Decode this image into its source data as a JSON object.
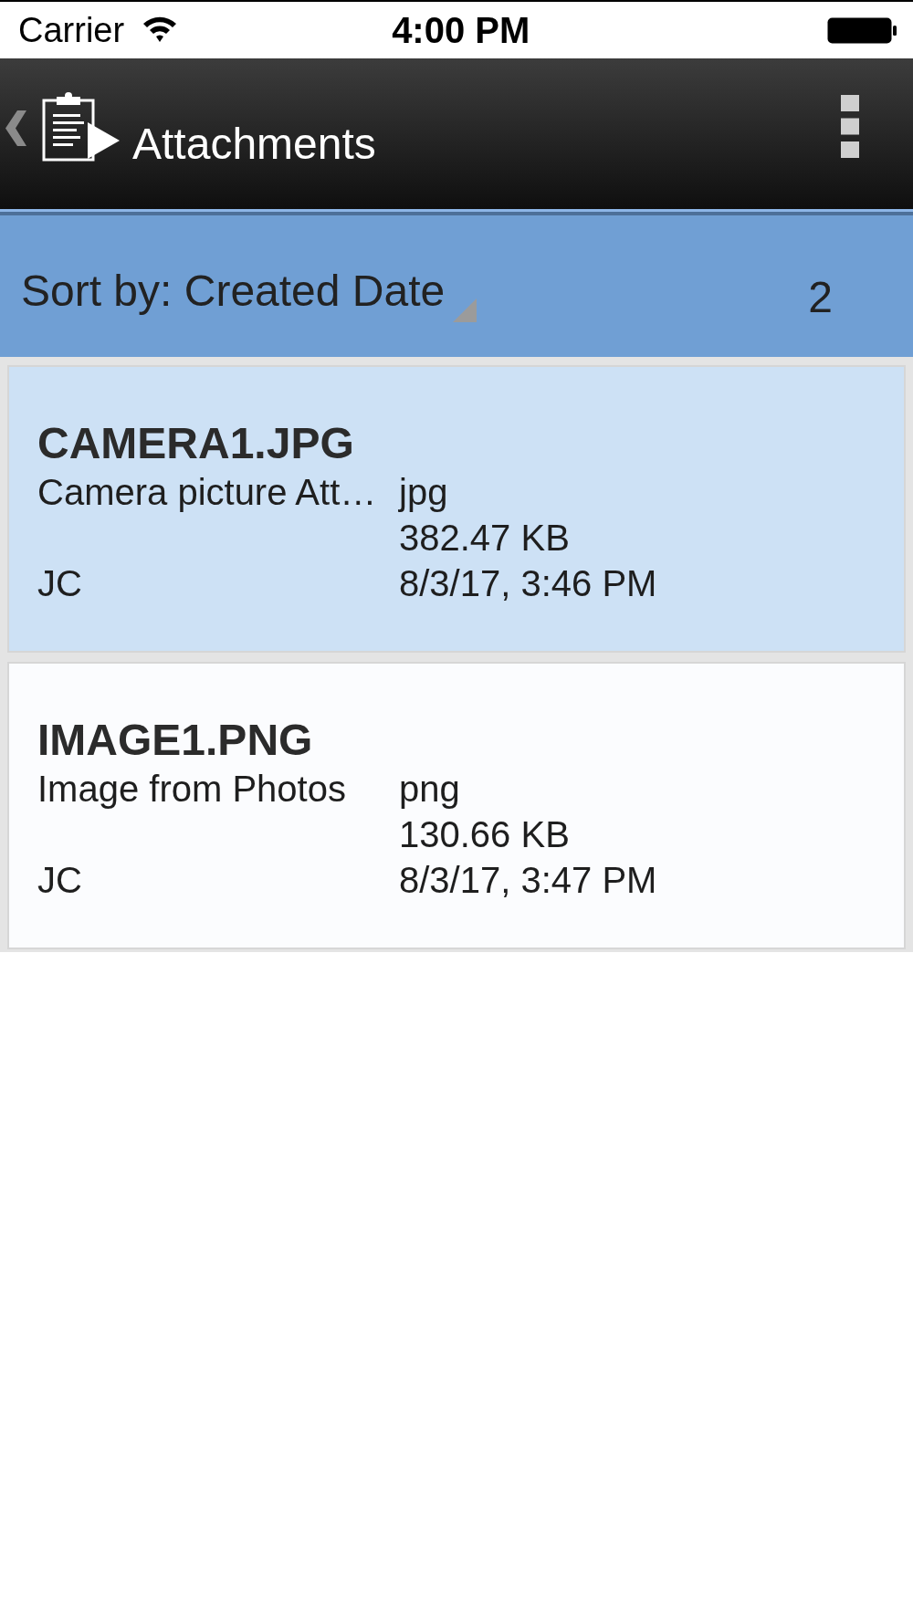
{
  "status_bar": {
    "carrier": "Carrier",
    "time": "4:00 PM"
  },
  "nav_bar": {
    "title": "Attachments"
  },
  "sort_bar": {
    "label": "Sort by: Created Date",
    "count": "2"
  },
  "attachments": [
    {
      "name": "CAMERA1.JPG",
      "description": "Camera picture Att…",
      "type": "jpg",
      "size": "382.47 KB",
      "author": "JC",
      "date": "8/3/17, 3:46 PM",
      "selected": true
    },
    {
      "name": "IMAGE1.PNG",
      "description": "Image from Photos",
      "type": "png",
      "size": "130.66 KB",
      "author": "JC",
      "date": "8/3/17, 3:47 PM",
      "selected": false
    }
  ]
}
